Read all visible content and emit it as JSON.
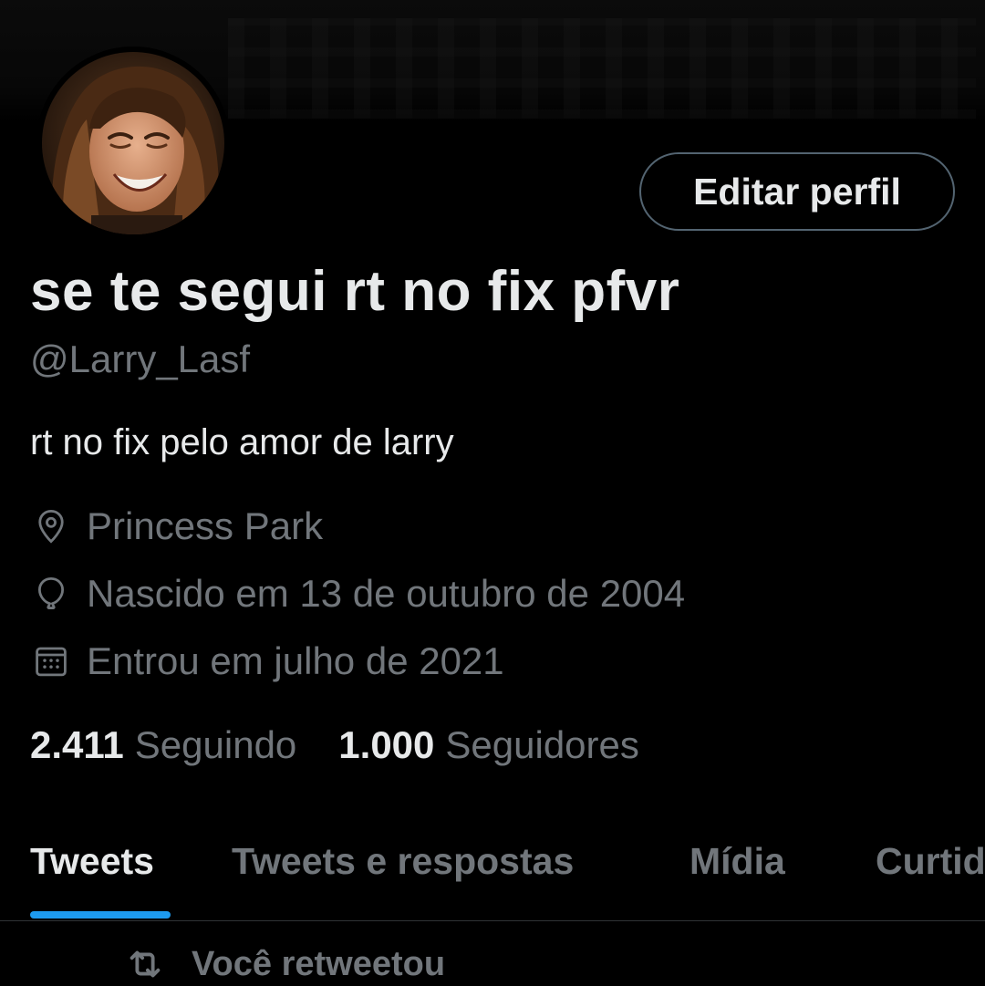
{
  "profile": {
    "edit_button_label": "Editar perfil",
    "display_name": "se te segui rt no fix pfvr",
    "handle": "@Larry_Lasf",
    "bio": "rt no fix pelo amor de larry",
    "location": "Princess Park",
    "birth": "Nascido em 13 de outubro de 2004",
    "joined": "Entrou em julho de 2021",
    "following_count": "2.411",
    "following_label": "Seguindo",
    "followers_count": "1.000",
    "followers_label": "Seguidores"
  },
  "tabs": [
    {
      "label": "Tweets",
      "active": true
    },
    {
      "label": "Tweets e respostas",
      "active": false
    },
    {
      "label": "Mídia",
      "active": false
    },
    {
      "label": "Curtidas",
      "active": false
    }
  ],
  "feed": {
    "retweet_label": "Você retweetou"
  },
  "icons": {
    "location": "location-pin-icon",
    "birth": "balloon-icon",
    "joined": "calendar-icon",
    "retweet": "retweet-icon"
  },
  "colors": {
    "background": "#000000",
    "primary_text": "#e7e9ea",
    "secondary_text": "#71767b",
    "accent": "#1d9bf0",
    "border": "#536471"
  }
}
